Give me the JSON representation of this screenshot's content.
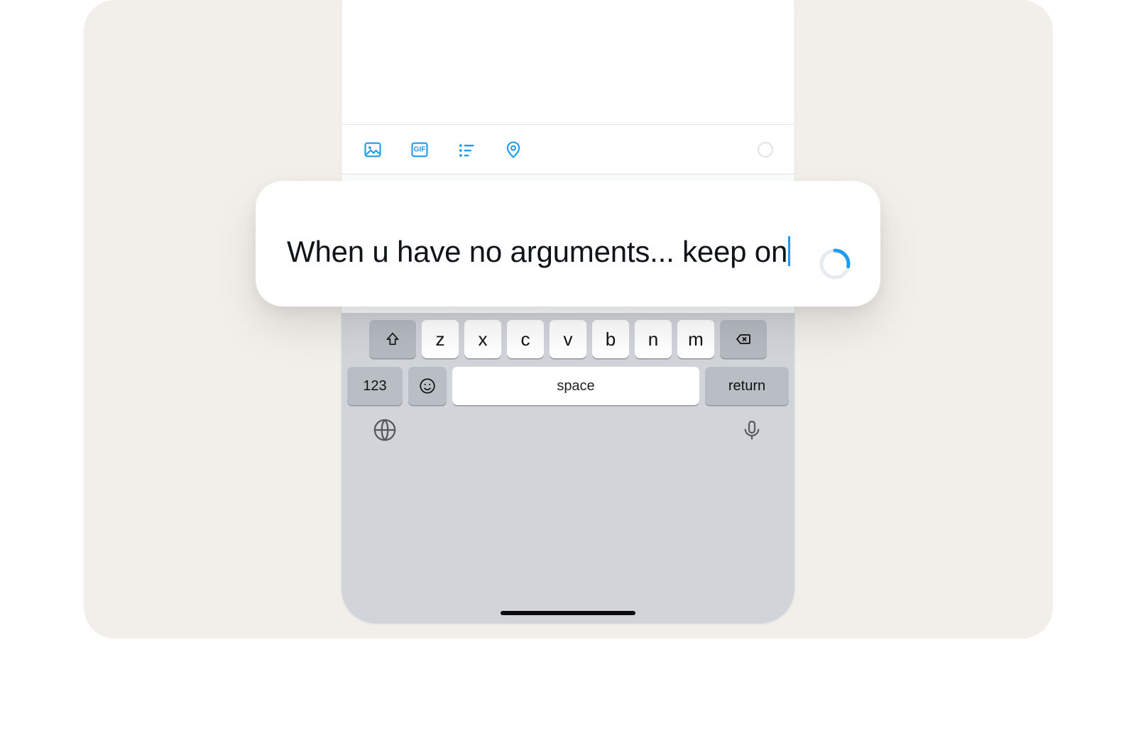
{
  "toolbar": {
    "icons": {
      "image": "image-icon",
      "gif": "gif-icon",
      "gif_label": "GIF",
      "poll": "poll-icon",
      "location": "location-icon"
    }
  },
  "compose": {
    "text": "When u have no arguments... keep on"
  },
  "keyboard": {
    "row3": [
      "z",
      "x",
      "c",
      "v",
      "b",
      "n",
      "m"
    ],
    "numbers_label": "123",
    "space_label": "space",
    "return_label": "return"
  }
}
